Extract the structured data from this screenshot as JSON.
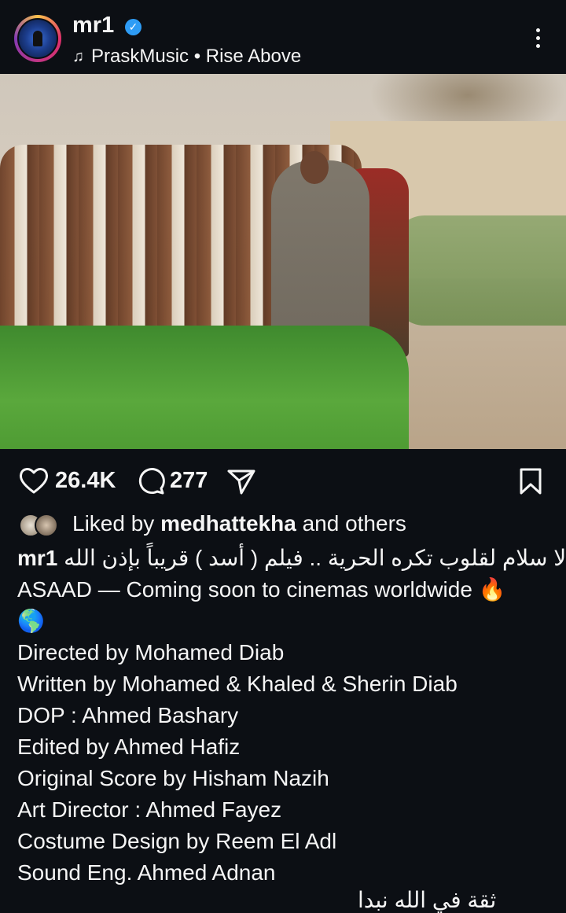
{
  "header": {
    "username": "mr1",
    "verified_icon": "verified-badge-icon",
    "music_note_icon": "music-note-icon",
    "music": "PraskMusic • Rise Above",
    "more_icon": "more-options-icon"
  },
  "post": {
    "image_alt": "Film still: a line of chained captives with a man in a grey robe and a masked guard",
    "user_tag_icon": "user-tag-icon",
    "audio_icon": "audio-speaker-icon"
  },
  "actions": {
    "likes": "26.4K",
    "comments": "277",
    "like_icon": "heart-icon",
    "comment_icon": "comment-icon",
    "share_icon": "share-icon",
    "save_icon": "bookmark-icon"
  },
  "liked_by": {
    "prefix": "Liked by ",
    "user": "medhattekha",
    "suffix": " and others"
  },
  "caption": {
    "username": "mr1",
    "arabic": "لا سلام لقلوب تكره الحرية .. فيلم ( أسد ) قريباً بإذن الله",
    "lines": [
      "ASAAD — Coming soon to cinemas worldwide 🔥",
      "🌎",
      "Directed by Mohamed Diab",
      "Written by Mohamed & Khaled & Sherin Diab",
      "DOP : Ahmed Bashary",
      "Edited by Ahmed Hafiz",
      "Original Score by Hisham Nazih",
      "Art Director : Ahmed Fayez",
      "Costume Design by Reem El Adl",
      "Sound Eng. Ahmed Adnan"
    ],
    "cut_off": "ثقة في الله نبدا"
  }
}
